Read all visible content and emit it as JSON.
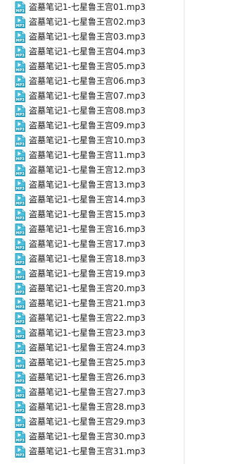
{
  "file_icon": "mp3-file-icon",
  "colors": {
    "icon_body": "#4fc0dc",
    "icon_dark": "#2a9fbf",
    "text": "#1e1e1e",
    "background": "#ffffff"
  },
  "files": [
    "盗墓笔记1-七星鲁王宫01.mp3",
    "盗墓笔记1-七星鲁王宫02.mp3",
    "盗墓笔记1-七星鲁王宫03.mp3",
    "盗墓笔记1-七星鲁王宫04.mp3",
    "盗墓笔记1-七星鲁王宫05.mp3",
    "盗墓笔记1-七星鲁王宫06.mp3",
    "盗墓笔记1-七星鲁王宫07.mp3",
    "盗墓笔记1-七星鲁王宫08.mp3",
    "盗墓笔记1-七星鲁王宫09.mp3",
    "盗墓笔记1-七星鲁王宫10.mp3",
    "盗墓笔记1-七星鲁王宫11.mp3",
    "盗墓笔记1-七星鲁王宫12.mp3",
    "盗墓笔记1-七星鲁王宫13.mp3",
    "盗墓笔记1-七星鲁王宫14.mp3",
    "盗墓笔记1-七星鲁王宫15.mp3",
    "盗墓笔记1-七星鲁王宫16.mp3",
    "盗墓笔记1-七星鲁王宫17.mp3",
    "盗墓笔记1-七星鲁王宫18.mp3",
    "盗墓笔记1-七星鲁王宫19.mp3",
    "盗墓笔记1-七星鲁王宫20.mp3",
    "盗墓笔记1-七星鲁王宫21.mp3",
    "盗墓笔记1-七星鲁王宫22.mp3",
    "盗墓笔记1-七星鲁王宫23.mp3",
    "盗墓笔记1-七星鲁王宫24.mp3",
    "盗墓笔记1-七星鲁王宫25.mp3",
    "盗墓笔记1-七星鲁王宫26.mp3",
    "盗墓笔记1-七星鲁王宫27.mp3",
    "盗墓笔记1-七星鲁王宫28.mp3",
    "盗墓笔记1-七星鲁王宫29.mp3",
    "盗墓笔记1-七星鲁王宫30.mp3",
    "盗墓笔记1-七星鲁王宫31.mp3"
  ]
}
